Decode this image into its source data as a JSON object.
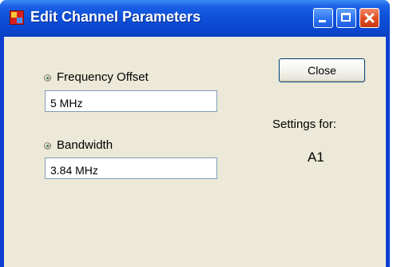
{
  "window": {
    "title": "Edit Channel Parameters"
  },
  "fields": {
    "frequency_offset": {
      "label": "Frequency Offset",
      "value": "5 MHz"
    },
    "bandwidth": {
      "label": "Bandwidth",
      "value": "3.84 MHz"
    }
  },
  "close_button": {
    "label": "Close"
  },
  "settings": {
    "label": "Settings for:",
    "channel": "A1"
  },
  "colors": {
    "titlebar": "#0a48cf",
    "client_bg": "#ece9d8",
    "close_btn_accent": "#e04a20"
  },
  "icons": [
    "app-icon",
    "minimize-icon",
    "maximize-icon",
    "close-icon",
    "radio-indicator-icon"
  ]
}
